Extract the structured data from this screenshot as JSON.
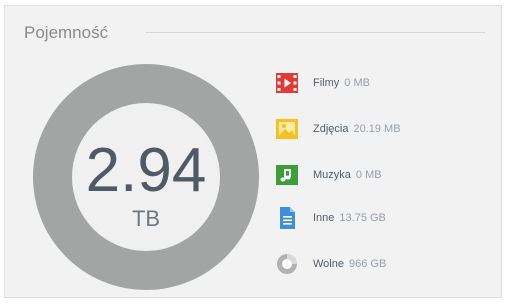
{
  "widget": {
    "title": "Pojemność"
  },
  "donut": {
    "value": "2.94",
    "unit": "TB",
    "color_ring": "#a3a5a4",
    "color_center": "#f0f0f0"
  },
  "legend": [
    {
      "name": "Filmy",
      "size": "0 MB",
      "icon": "film-icon",
      "color": "#e53935"
    },
    {
      "name": "Zdjęcia",
      "size": "20.19 MB",
      "icon": "image-icon",
      "color": "#f6c01f"
    },
    {
      "name": "Muzyka",
      "size": "0 MB",
      "icon": "music-icon",
      "color": "#3c9e3a"
    },
    {
      "name": "Inne",
      "size": "13.75 GB",
      "icon": "document-icon",
      "color": "#3d8fd8"
    },
    {
      "name": "Wolne",
      "size": "966 GB",
      "icon": "pie-chart-icon",
      "color": "#b2b2b2"
    }
  ]
}
